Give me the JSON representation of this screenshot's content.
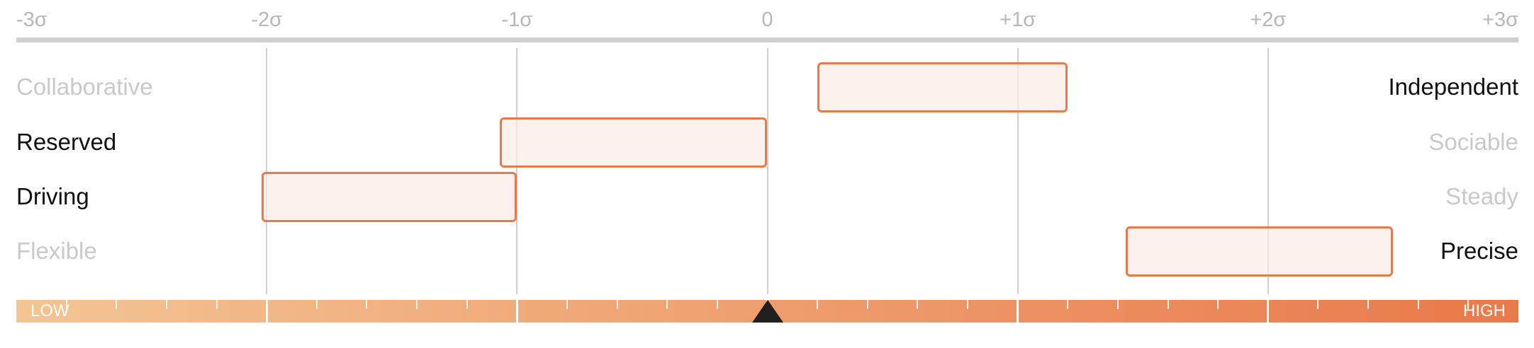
{
  "scale": {
    "ticks": [
      {
        "label": "-3σ",
        "value": -3
      },
      {
        "label": "-2σ",
        "value": -2
      },
      {
        "label": "-1σ",
        "value": -1
      },
      {
        "label": "0",
        "value": 0
      },
      {
        "label": "+1σ",
        "value": 1
      },
      {
        "label": "+2σ",
        "value": 2
      },
      {
        "label": "+3σ",
        "value": 3
      }
    ]
  },
  "rows": [
    {
      "left": "Collaborative",
      "right": "Independent",
      "emphasis": "right",
      "range": [
        0.2,
        1.2
      ]
    },
    {
      "left": "Reserved",
      "right": "Sociable",
      "emphasis": "left",
      "range": [
        -1.07,
        0.0
      ]
    },
    {
      "left": "Driving",
      "right": "Steady",
      "emphasis": "left",
      "range": [
        -2.02,
        -1.0
      ]
    },
    {
      "left": "Flexible",
      "right": "Precise",
      "emphasis": "right",
      "range": [
        1.43,
        2.5
      ]
    }
  ],
  "gauge": {
    "low_label": "LOW",
    "high_label": "HIGH",
    "marker_value": 0,
    "colors": {
      "start": "#f4c493",
      "end": "#e9794a",
      "marker": "#1f1f1f"
    }
  },
  "colors": {
    "bar_fill": "#fbece6",
    "bar_border": "#e77a4c",
    "dim_text": "#c9c9c9",
    "strong_text": "#111111"
  }
}
